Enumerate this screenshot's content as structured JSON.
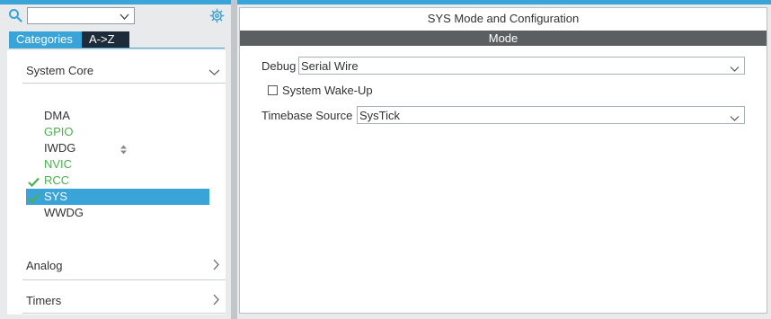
{
  "left": {
    "search_value": "",
    "tabs": [
      {
        "label": "Categories",
        "active": true
      },
      {
        "label": "A->Z",
        "active": false
      }
    ],
    "categories": [
      {
        "label": "System Core",
        "expanded": true
      },
      {
        "label": "Analog",
        "expanded": false
      },
      {
        "label": "Timers",
        "expanded": false
      }
    ],
    "system_core_items": [
      {
        "label": "DMA",
        "status": "normal",
        "checked": false,
        "selected": false
      },
      {
        "label": "GPIO",
        "status": "green",
        "checked": false,
        "selected": false
      },
      {
        "label": "IWDG",
        "status": "normal",
        "checked": false,
        "selected": false
      },
      {
        "label": "NVIC",
        "status": "green",
        "checked": false,
        "selected": false
      },
      {
        "label": "RCC",
        "status": "green",
        "checked": true,
        "selected": false
      },
      {
        "label": "SYS",
        "status": "green",
        "checked": true,
        "selected": true
      },
      {
        "label": "WWDG",
        "status": "normal",
        "checked": false,
        "selected": false
      }
    ]
  },
  "right": {
    "title": "SYS Mode and Configuration",
    "mode_header": "Mode",
    "debug": {
      "label": "Debug",
      "value": "Serial Wire"
    },
    "wakeup": {
      "label": "System Wake-Up",
      "checked": false
    },
    "timebase": {
      "label": "Timebase Source",
      "value": "SysTick"
    }
  },
  "colors": {
    "accent": "#3aa3d8",
    "green": "#4caf50",
    "mode_bar": "#5c5f61",
    "tab_dark": "#1d2b3a"
  },
  "icons": [
    "search-icon",
    "gear-icon",
    "chevron-down-icon",
    "chevron-right-icon",
    "sort-icon",
    "check-icon"
  ]
}
